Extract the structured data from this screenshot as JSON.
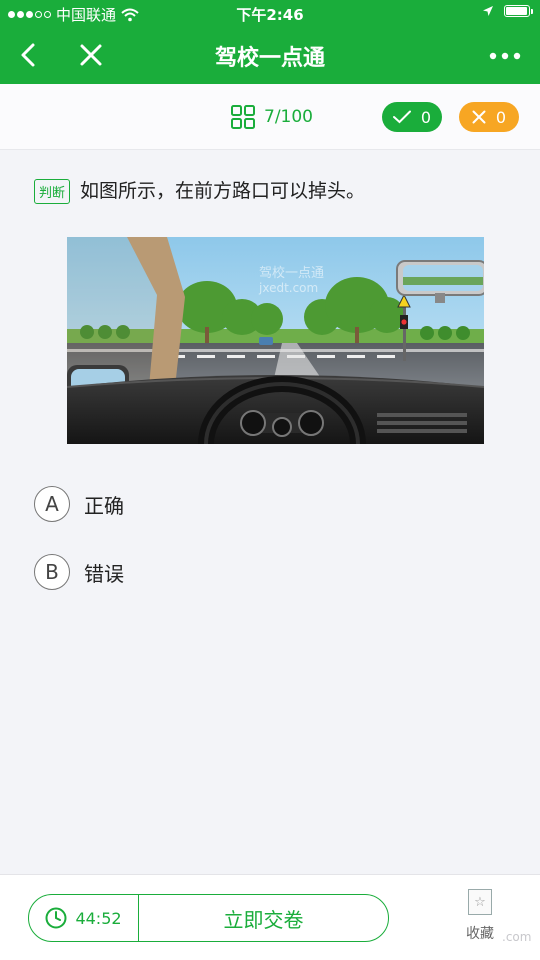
{
  "status_bar": {
    "carrier": "中国联通",
    "time": "下午2:46",
    "signal_dots_filled": 3,
    "signal_dots_total": 5,
    "battery_level": 0.95
  },
  "nav": {
    "title": "驾校一点通",
    "back_icon": "chevron-left-icon",
    "close_icon": "close-icon",
    "more_icon": "more-dots-icon"
  },
  "toolbar": {
    "progress": "7/100",
    "correct_count": "0",
    "wrong_count": "0"
  },
  "question": {
    "type_tag": "判断",
    "text": "如图所示，在前方路口可以掉头。",
    "image_watermark": "驾校一点通 jxedt.com"
  },
  "options": [
    {
      "letter": "A",
      "label": "正确"
    },
    {
      "letter": "B",
      "label": "错误"
    }
  ],
  "bottom": {
    "timer": "44:52",
    "submit_label": "立即交卷",
    "favorite_label": "收藏",
    "watermark": ".com"
  },
  "colors": {
    "brand_green": "#1aad3b",
    "wrong_orange": "#f7a623",
    "page_bg": "#f3f4f8"
  }
}
